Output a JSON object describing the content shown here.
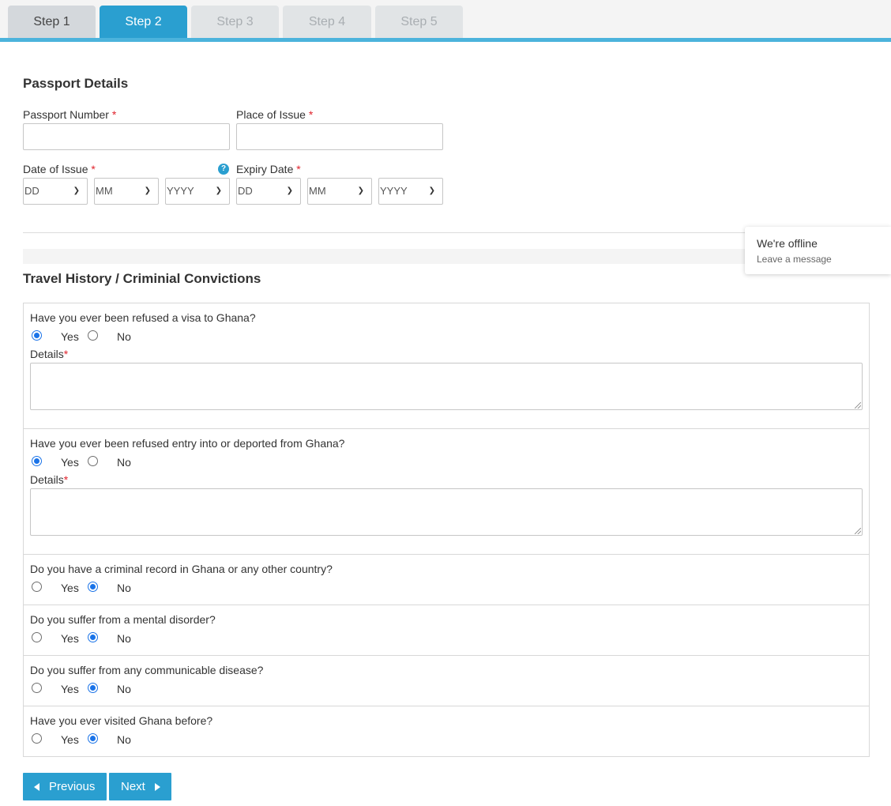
{
  "tabs": [
    {
      "label": "Step 1",
      "state": "done"
    },
    {
      "label": "Step 2",
      "state": "active"
    },
    {
      "label": "Step 3",
      "state": "disabled"
    },
    {
      "label": "Step 4",
      "state": "disabled"
    },
    {
      "label": "Step 5",
      "state": "disabled"
    }
  ],
  "passport": {
    "title": "Passport Details",
    "number_label": "Passport Number",
    "place_label": "Place of Issue",
    "issue_date_label": "Date of Issue",
    "expiry_date_label": "Expiry Date",
    "required_mark": "*",
    "help_icon": "?",
    "issue_dd": "DD",
    "issue_mm": "MM",
    "issue_yyyy": "YYYY",
    "expiry_dd": "DD",
    "expiry_mm": "MM",
    "expiry_yyyy": "YYYY"
  },
  "chat": {
    "status": "We're offline",
    "action": "Leave a message"
  },
  "travel": {
    "title": "Travel History / Criminial Convictions",
    "yes": "Yes",
    "no": "No",
    "details_label": "Details",
    "questions": [
      {
        "text": "Have you ever been refused a visa to Ghana?",
        "answer": "Yes"
      },
      {
        "text": "Have you ever been refused entry into or deported from Ghana?",
        "answer": "Yes"
      },
      {
        "text": "Do you have a criminal record in Ghana or any other country?",
        "answer": "No"
      },
      {
        "text": "Do you suffer from a mental disorder?",
        "answer": "No"
      },
      {
        "text": "Do you suffer from any communicable disease?",
        "answer": "No"
      },
      {
        "text": "Have you ever visited Ghana before?",
        "answer": "No"
      }
    ]
  },
  "nav": {
    "previous": "Previous",
    "next": "Next"
  },
  "colors": {
    "accent": "#2a9fd0",
    "tab_line": "#4cb3dc",
    "required": "#e0242d",
    "radio_checked": "#1a73e8"
  }
}
